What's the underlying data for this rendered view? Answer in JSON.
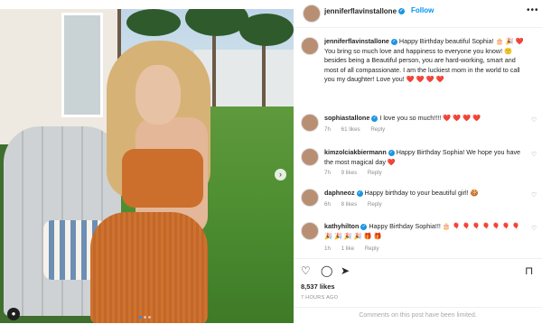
{
  "header": {
    "username": "jenniferflavinstallone",
    "follow_label": "Follow",
    "more_icon": "more-horizontal-icon"
  },
  "caption": {
    "username": "jenniferflavinstallone",
    "text": "Happy Birthday beautiful Sophia! 🎂 🎉 ❤️ You bring so much love and happiness to everyone you know! 🙂 besides being a Beautiful person, you are hard-working, smart and most of all compassionate. I am the luckiest mom in the world to call you my daughter! Love you! ❤️ ❤️ ❤️ ❤️"
  },
  "comments": [
    {
      "username": "sophiastallone",
      "text": "I love you so much!!!! ❤️ ❤️ ❤️ ❤️",
      "age": "7h",
      "likes": "61 likes"
    },
    {
      "username": "kimzolciakbiermann",
      "text": "Happy Birthday Sophia! We hope you have the most magical day ❤️",
      "age": "7h",
      "likes": "9 likes"
    },
    {
      "username": "daphneoz",
      "text": "Happy birthday to your beautiful girl! 🍪",
      "age": "6h",
      "likes": "8 likes"
    },
    {
      "username": "kathyhilton",
      "text": "Happy Birthday Sophia!!! 🎂 🎈 🎈 🎈 🎈 🎈 🎈 🎈 🎉 🎉 🎉 🎉 🎁 🎁",
      "age": "1h",
      "likes": "1 like"
    }
  ],
  "reply_label": "Reply",
  "actions": {
    "like_icon": "heart-icon",
    "comment_icon": "comment-icon",
    "share_icon": "share-icon",
    "save_icon": "bookmark-icon"
  },
  "likes_count": "8,537 likes",
  "posted_ago": "7 HOURS AGO",
  "comments_limited": "Comments on this post have been limited.",
  "colors": {
    "link_blue": "#0095f6",
    "verified_blue": "#1b95e0",
    "text": "#262626",
    "muted": "#8e8e8e"
  }
}
